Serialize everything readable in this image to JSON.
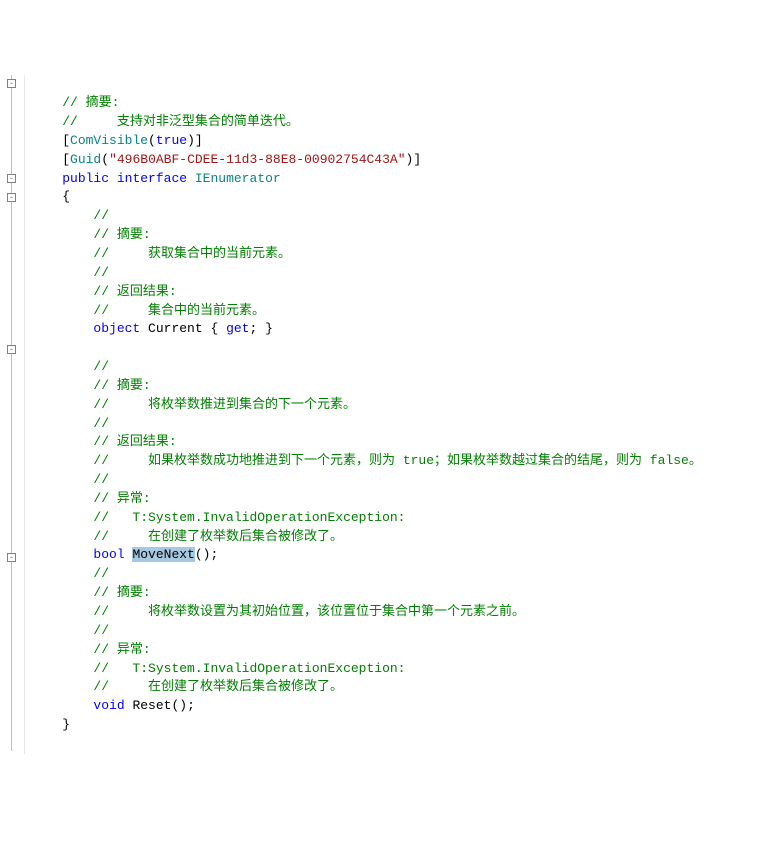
{
  "lines": {
    "l1": "// 摘要:",
    "l2": "//     支持对非泛型集合的简单迭代。",
    "l3a": "ComVisible",
    "l3b": "true",
    "l4a": "Guid",
    "l4b": "\"496B0ABF-CDEE-11d3-88E8-00902754C43A\"",
    "l5a": "public",
    "l5b": "interface",
    "l5c": "IEnumerator",
    "l6": "{",
    "l7": "//",
    "l8": "// 摘要:",
    "l9": "//     获取集合中的当前元素。",
    "l10": "//",
    "l11": "// 返回结果:",
    "l12": "//     集合中的当前元素。",
    "l13a": "object",
    "l13b": "Current",
    "l13c": "get",
    "l14": "",
    "l15": "//",
    "l16": "// 摘要:",
    "l17": "//     将枚举数推进到集合的下一个元素。",
    "l18": "//",
    "l19": "// 返回结果:",
    "l20": "//     如果枚举数成功地推进到下一个元素，则为 true；如果枚举数越过集合的结尾，则为 false。",
    "l21": "//",
    "l22": "// 异常:",
    "l23": "//   T:System.InvalidOperationException:",
    "l24": "//     在创建了枚举数后集合被修改了。",
    "l25a": "bool",
    "l25b": "MoveNext",
    "l26": "//",
    "l27": "// 摘要:",
    "l28": "//     将枚举数设置为其初始位置，该位置位于集合中第一个元素之前。",
    "l29": "//",
    "l30": "// 异常:",
    "l31": "//   T:System.InvalidOperationException:",
    "l32": "//     在创建了枚举数后集合被修改了。",
    "l33a": "void",
    "l33b": "Reset",
    "l34": "}"
  },
  "fold_glyph": "-"
}
